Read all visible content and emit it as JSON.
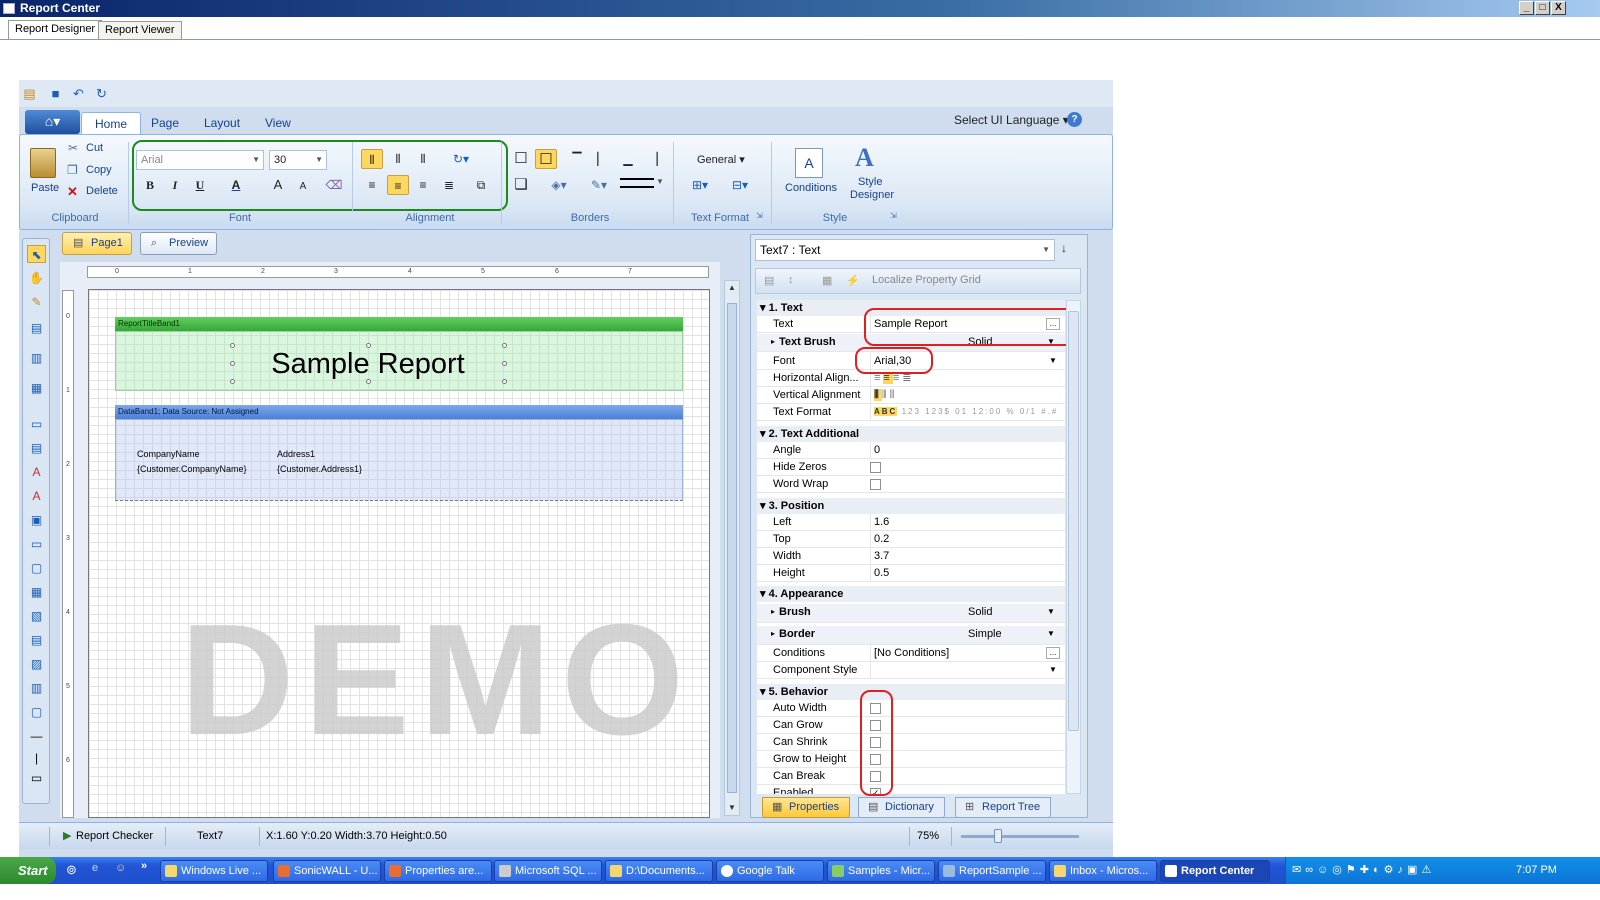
{
  "window": {
    "title": "Report Center",
    "minimize": "_",
    "maximize": "□",
    "close": "X"
  },
  "top_tabs": [
    "Report Designer",
    "Report Viewer"
  ],
  "ribbon": {
    "tabs": [
      "Home",
      "Page",
      "Layout",
      "View"
    ],
    "ui_language": "Select UI Language",
    "clipboard": {
      "paste": "Paste",
      "cut": "Cut",
      "copy": "Copy",
      "delete": "Delete",
      "label": "Clipboard"
    },
    "font": {
      "family": "Arial",
      "size": "30",
      "label": "Font",
      "bold": "B",
      "italic": "I",
      "underline": "U",
      "color": "A",
      "grow": "A",
      "shrink": "A"
    },
    "alignment": {
      "label": "Alignment"
    },
    "borders": {
      "label": "Borders"
    },
    "text_format": {
      "value": "General",
      "label": "Text Format"
    },
    "style": {
      "conditions": "Conditions",
      "style_designer_1": "Style",
      "style_designer_2": "Designer",
      "label": "Style"
    }
  },
  "designer": {
    "page_tab": "Page1",
    "preview_tab": "Preview",
    "ruler_h": [
      "0",
      "1",
      "2",
      "3",
      "4",
      "5",
      "6",
      "7"
    ],
    "ruler_v": [
      "0",
      "1",
      "2",
      "3",
      "4",
      "5",
      "6"
    ],
    "title_band": "ReportTitleBand1",
    "title_text": "Sample Report",
    "data_band": "DataBand1; Data Source: Not Assigned",
    "fields": {
      "company_label": "CompanyName",
      "company_value": "{Customer.CompanyName}",
      "address_label": "Address1",
      "address_value": "{Customer.Address1}"
    },
    "watermark": "DEMO"
  },
  "properties": {
    "object": "Text7 : Text",
    "localize": "Localize Property Grid",
    "categories": {
      "text": "1. Text",
      "text_additional": "2. Text  Additional",
      "position": "3. Position",
      "appearance": "4. Appearance",
      "behavior": "5. Behavior"
    },
    "text": {
      "text_name": "Text",
      "text_value": "Sample Report",
      "brush_name": "Text Brush",
      "brush_value": "Solid",
      "font_name": "Font",
      "font_value": "Arial,30",
      "halign": "Horizontal Align...",
      "valign": "Vertical Alignment",
      "format": "Text Format"
    },
    "text_additional": {
      "angle_name": "Angle",
      "angle_value": "0",
      "hide_zeros": "Hide Zeros",
      "word_wrap": "Word Wrap"
    },
    "position": {
      "left_name": "Left",
      "left_value": "1.6",
      "top_name": "Top",
      "top_value": "0.2",
      "width_name": "Width",
      "width_value": "3.7",
      "height_name": "Height",
      "height_value": "0.5"
    },
    "appearance": {
      "brush_name": "Brush",
      "brush_value": "Solid",
      "border_name": "Border",
      "border_value": "Simple",
      "conditions_name": "Conditions",
      "conditions_value": "[No Conditions]",
      "component_style": "Component Style"
    },
    "behavior": [
      "Auto Width",
      "Can Grow",
      "Can Shrink",
      "Grow to Height",
      "Can Break",
      "Enabled"
    ],
    "bottom_tabs": [
      "Properties",
      "Dictionary",
      "Report Tree"
    ]
  },
  "status": {
    "checker": "Report Checker",
    "component": "Text7",
    "coords": "X:1.60  Y:0.20  Width:3.70  Height:0.50",
    "zoom": "75%"
  },
  "taskbar": {
    "start": "Start",
    "tasks": [
      "Windows Live ...",
      "SonicWALL - U...",
      "Properties are...",
      "Microsoft SQL ...",
      "D:\\Documents...",
      "Google Talk",
      "Samples - Micr...",
      "ReportSample ...",
      "Inbox - Micros...",
      "Report Center"
    ],
    "clock": "7:07 PM"
  }
}
